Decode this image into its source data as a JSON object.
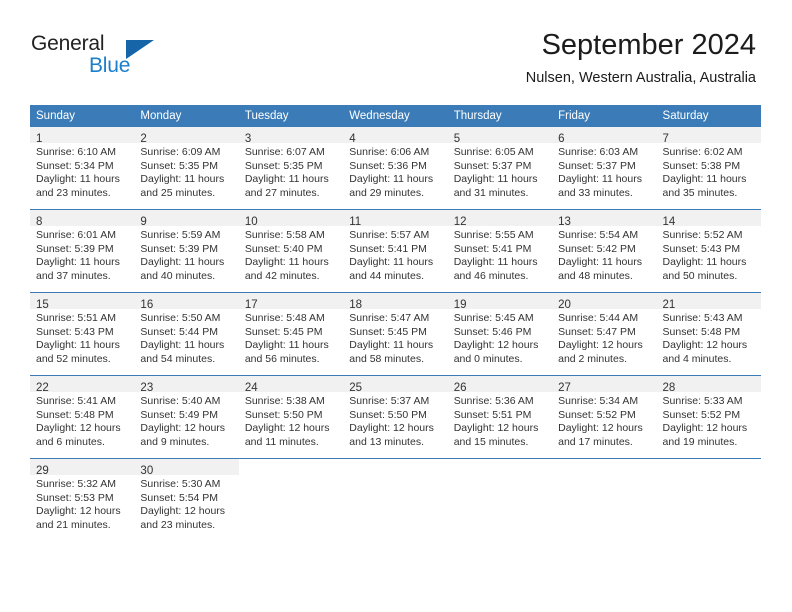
{
  "brand": {
    "name_part1": "General",
    "name_part2": "Blue",
    "mark": "triangle-logo",
    "accent_color": "#1b7fcc",
    "mark_color": "#1565a8"
  },
  "header": {
    "title": "September 2024",
    "location": "Nulsen, Western Australia, Australia"
  },
  "calendar": {
    "header_color": "#3b7cb8",
    "daynum_band_color": "#f1f1f1",
    "weekday_headers": [
      "Sunday",
      "Monday",
      "Tuesday",
      "Wednesday",
      "Thursday",
      "Friday",
      "Saturday"
    ],
    "weeks": [
      [
        {
          "day": "1",
          "sunrise": "Sunrise: 6:10 AM",
          "sunset": "Sunset: 5:34 PM",
          "daylight1": "Daylight: 11 hours",
          "daylight2": "and 23 minutes."
        },
        {
          "day": "2",
          "sunrise": "Sunrise: 6:09 AM",
          "sunset": "Sunset: 5:35 PM",
          "daylight1": "Daylight: 11 hours",
          "daylight2": "and 25 minutes."
        },
        {
          "day": "3",
          "sunrise": "Sunrise: 6:07 AM",
          "sunset": "Sunset: 5:35 PM",
          "daylight1": "Daylight: 11 hours",
          "daylight2": "and 27 minutes."
        },
        {
          "day": "4",
          "sunrise": "Sunrise: 6:06 AM",
          "sunset": "Sunset: 5:36 PM",
          "daylight1": "Daylight: 11 hours",
          "daylight2": "and 29 minutes."
        },
        {
          "day": "5",
          "sunrise": "Sunrise: 6:05 AM",
          "sunset": "Sunset: 5:37 PM",
          "daylight1": "Daylight: 11 hours",
          "daylight2": "and 31 minutes."
        },
        {
          "day": "6",
          "sunrise": "Sunrise: 6:03 AM",
          "sunset": "Sunset: 5:37 PM",
          "daylight1": "Daylight: 11 hours",
          "daylight2": "and 33 minutes."
        },
        {
          "day": "7",
          "sunrise": "Sunrise: 6:02 AM",
          "sunset": "Sunset: 5:38 PM",
          "daylight1": "Daylight: 11 hours",
          "daylight2": "and 35 minutes."
        }
      ],
      [
        {
          "day": "8",
          "sunrise": "Sunrise: 6:01 AM",
          "sunset": "Sunset: 5:39 PM",
          "daylight1": "Daylight: 11 hours",
          "daylight2": "and 37 minutes."
        },
        {
          "day": "9",
          "sunrise": "Sunrise: 5:59 AM",
          "sunset": "Sunset: 5:39 PM",
          "daylight1": "Daylight: 11 hours",
          "daylight2": "and 40 minutes."
        },
        {
          "day": "10",
          "sunrise": "Sunrise: 5:58 AM",
          "sunset": "Sunset: 5:40 PM",
          "daylight1": "Daylight: 11 hours",
          "daylight2": "and 42 minutes."
        },
        {
          "day": "11",
          "sunrise": "Sunrise: 5:57 AM",
          "sunset": "Sunset: 5:41 PM",
          "daylight1": "Daylight: 11 hours",
          "daylight2": "and 44 minutes."
        },
        {
          "day": "12",
          "sunrise": "Sunrise: 5:55 AM",
          "sunset": "Sunset: 5:41 PM",
          "daylight1": "Daylight: 11 hours",
          "daylight2": "and 46 minutes."
        },
        {
          "day": "13",
          "sunrise": "Sunrise: 5:54 AM",
          "sunset": "Sunset: 5:42 PM",
          "daylight1": "Daylight: 11 hours",
          "daylight2": "and 48 minutes."
        },
        {
          "day": "14",
          "sunrise": "Sunrise: 5:52 AM",
          "sunset": "Sunset: 5:43 PM",
          "daylight1": "Daylight: 11 hours",
          "daylight2": "and 50 minutes."
        }
      ],
      [
        {
          "day": "15",
          "sunrise": "Sunrise: 5:51 AM",
          "sunset": "Sunset: 5:43 PM",
          "daylight1": "Daylight: 11 hours",
          "daylight2": "and 52 minutes."
        },
        {
          "day": "16",
          "sunrise": "Sunrise: 5:50 AM",
          "sunset": "Sunset: 5:44 PM",
          "daylight1": "Daylight: 11 hours",
          "daylight2": "and 54 minutes."
        },
        {
          "day": "17",
          "sunrise": "Sunrise: 5:48 AM",
          "sunset": "Sunset: 5:45 PM",
          "daylight1": "Daylight: 11 hours",
          "daylight2": "and 56 minutes."
        },
        {
          "day": "18",
          "sunrise": "Sunrise: 5:47 AM",
          "sunset": "Sunset: 5:45 PM",
          "daylight1": "Daylight: 11 hours",
          "daylight2": "and 58 minutes."
        },
        {
          "day": "19",
          "sunrise": "Sunrise: 5:45 AM",
          "sunset": "Sunset: 5:46 PM",
          "daylight1": "Daylight: 12 hours",
          "daylight2": "and 0 minutes."
        },
        {
          "day": "20",
          "sunrise": "Sunrise: 5:44 AM",
          "sunset": "Sunset: 5:47 PM",
          "daylight1": "Daylight: 12 hours",
          "daylight2": "and 2 minutes."
        },
        {
          "day": "21",
          "sunrise": "Sunrise: 5:43 AM",
          "sunset": "Sunset: 5:48 PM",
          "daylight1": "Daylight: 12 hours",
          "daylight2": "and 4 minutes."
        }
      ],
      [
        {
          "day": "22",
          "sunrise": "Sunrise: 5:41 AM",
          "sunset": "Sunset: 5:48 PM",
          "daylight1": "Daylight: 12 hours",
          "daylight2": "and 6 minutes."
        },
        {
          "day": "23",
          "sunrise": "Sunrise: 5:40 AM",
          "sunset": "Sunset: 5:49 PM",
          "daylight1": "Daylight: 12 hours",
          "daylight2": "and 9 minutes."
        },
        {
          "day": "24",
          "sunrise": "Sunrise: 5:38 AM",
          "sunset": "Sunset: 5:50 PM",
          "daylight1": "Daylight: 12 hours",
          "daylight2": "and 11 minutes."
        },
        {
          "day": "25",
          "sunrise": "Sunrise: 5:37 AM",
          "sunset": "Sunset: 5:50 PM",
          "daylight1": "Daylight: 12 hours",
          "daylight2": "and 13 minutes."
        },
        {
          "day": "26",
          "sunrise": "Sunrise: 5:36 AM",
          "sunset": "Sunset: 5:51 PM",
          "daylight1": "Daylight: 12 hours",
          "daylight2": "and 15 minutes."
        },
        {
          "day": "27",
          "sunrise": "Sunrise: 5:34 AM",
          "sunset": "Sunset: 5:52 PM",
          "daylight1": "Daylight: 12 hours",
          "daylight2": "and 17 minutes."
        },
        {
          "day": "28",
          "sunrise": "Sunrise: 5:33 AM",
          "sunset": "Sunset: 5:52 PM",
          "daylight1": "Daylight: 12 hours",
          "daylight2": "and 19 minutes."
        }
      ],
      [
        {
          "day": "29",
          "sunrise": "Sunrise: 5:32 AM",
          "sunset": "Sunset: 5:53 PM",
          "daylight1": "Daylight: 12 hours",
          "daylight2": "and 21 minutes."
        },
        {
          "day": "30",
          "sunrise": "Sunrise: 5:30 AM",
          "sunset": "Sunset: 5:54 PM",
          "daylight1": "Daylight: 12 hours",
          "daylight2": "and 23 minutes."
        },
        {
          "day": "",
          "sunrise": "",
          "sunset": "",
          "daylight1": "",
          "daylight2": ""
        },
        {
          "day": "",
          "sunrise": "",
          "sunset": "",
          "daylight1": "",
          "daylight2": ""
        },
        {
          "day": "",
          "sunrise": "",
          "sunset": "",
          "daylight1": "",
          "daylight2": ""
        },
        {
          "day": "",
          "sunrise": "",
          "sunset": "",
          "daylight1": "",
          "daylight2": ""
        },
        {
          "day": "",
          "sunrise": "",
          "sunset": "",
          "daylight1": "",
          "daylight2": ""
        }
      ]
    ]
  }
}
